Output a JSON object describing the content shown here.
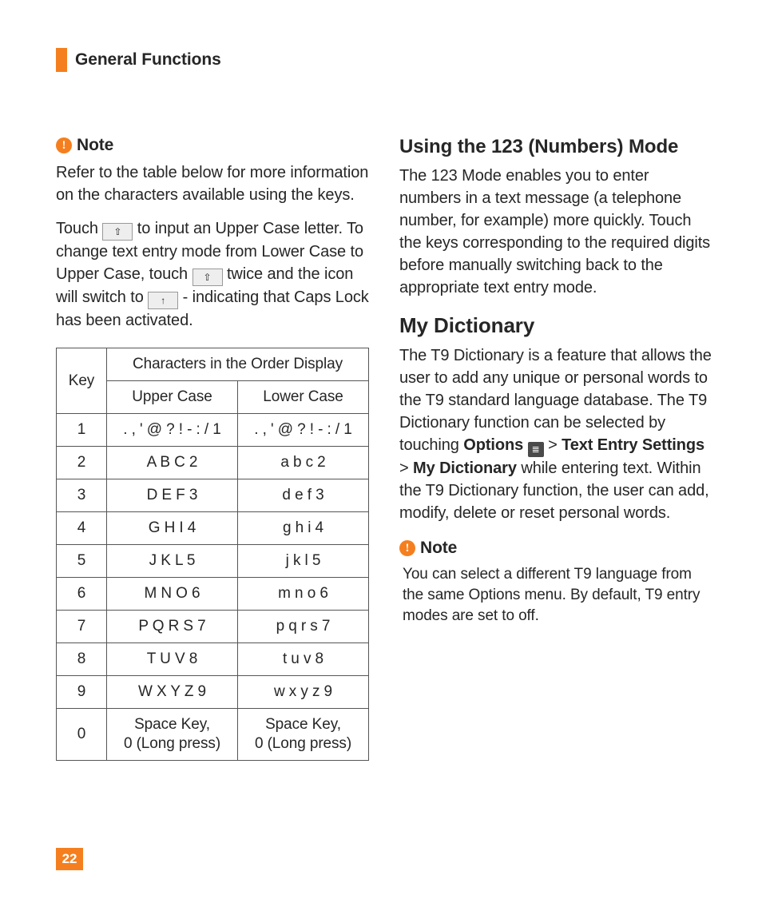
{
  "header": {
    "title": "General Functions"
  },
  "left": {
    "note_label": "Note",
    "para1": "Refer to the table below for more information on the characters available using the keys.",
    "para2_a": "Touch ",
    "para2_b": " to input an Upper Case letter. To change text entry mode from Lower Case to Upper Case, touch ",
    "para2_c": " twice and the icon will switch to ",
    "para2_d": " - indicating that Caps Lock has been activated.",
    "table": {
      "key_header": "Key",
      "span_header": "Characters in the Order Display",
      "upper_header": "Upper Case",
      "lower_header": "Lower Case",
      "rows": [
        {
          "key": "1",
          "upper": ". , ' @ ? ! - : / 1",
          "lower": ". , ' @ ? ! - : / 1"
        },
        {
          "key": "2",
          "upper": "A B C 2",
          "lower": "a b c 2"
        },
        {
          "key": "3",
          "upper": "D E F 3",
          "lower": "d e f 3"
        },
        {
          "key": "4",
          "upper": "G H I 4",
          "lower": "g h i 4"
        },
        {
          "key": "5",
          "upper": "J K L 5",
          "lower": "j k l 5"
        },
        {
          "key": "6",
          "upper": "M N O 6",
          "lower": "m n o 6"
        },
        {
          "key": "7",
          "upper": "P Q R S 7",
          "lower": "p q r s 7"
        },
        {
          "key": "8",
          "upper": "T U V 8",
          "lower": "t u v 8"
        },
        {
          "key": "9",
          "upper": "W X Y Z 9",
          "lower": "w x y z 9"
        },
        {
          "key": "0",
          "upper": "Space Key,\n0 (Long press)",
          "lower": "Space Key,\n0 (Long press)"
        }
      ]
    }
  },
  "right": {
    "h1": "Using the 123 (Numbers) Mode",
    "p1": "The 123 Mode enables you to enter numbers in a text message (a telephone number, for example) more quickly. Touch the keys corresponding to the required digits before manually switching back to the appropriate text entry mode.",
    "h2": "My Dictionary",
    "p2_a": "The T9 Dictionary is a feature that allows the user to add any unique or personal words to the T9 standard language database. The T9 Dictionary function can be selected by touching ",
    "p2_opt": "Options",
    "p2_gt1": " > ",
    "p2_tes": "Text Entry Settings",
    "p2_gt2": " > ",
    "p2_md": "My Dictionary",
    "p2_b": " while entering text. Within the T9 Dictionary function, the user can add, modify, delete or reset personal words.",
    "note_label": "Note",
    "note_text": "You can select a different T9 language from the same Options menu. By default, T9 entry modes are set to off."
  },
  "page_number": "22"
}
